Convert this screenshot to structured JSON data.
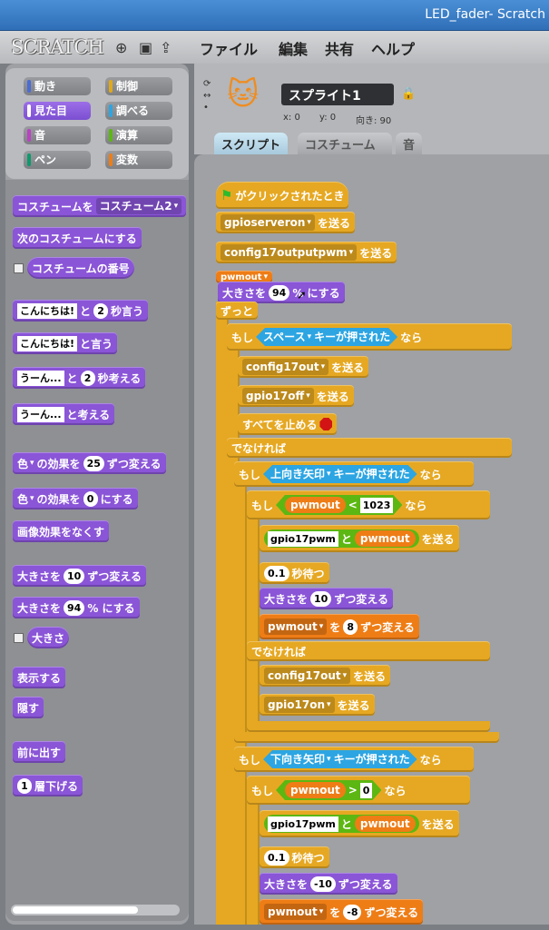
{
  "window": {
    "title": "LED_fader- Scratch"
  },
  "menu": {
    "logo": "SCRATCH",
    "items": [
      "ファイル",
      "編集",
      "共有",
      "ヘルプ"
    ]
  },
  "categories": [
    {
      "label": "動き",
      "color": "#4a6cd4"
    },
    {
      "label": "制御",
      "color": "#e1a91a"
    },
    {
      "label": "見た目",
      "color": "#8a55d7"
    },
    {
      "label": "調べる",
      "color": "#2ca5e2"
    },
    {
      "label": "音",
      "color": "#bb42c3"
    },
    {
      "label": "演算",
      "color": "#5cb712"
    },
    {
      "label": "ペン",
      "color": "#0e9a6c"
    },
    {
      "label": "変数",
      "color": "#ee7d16"
    }
  ],
  "palette": {
    "costume_to": "コスチュームを",
    "costume_name": "コスチューム2",
    "next_costume": "次のコスチュームにする",
    "costume_number": "コスチュームの番号",
    "say_for_text": "こんにちは!",
    "say_for_and": "と",
    "say_for_secs": "2",
    "say_for_suffix": "秒言う",
    "say_text": "こんにちは!",
    "say_suffix": "と言う",
    "think_for_text": "うーん...",
    "think_for_and": "と",
    "think_for_secs": "2",
    "think_for_suffix": "秒考える",
    "think_text": "うーん...",
    "think_suffix": "と考える",
    "effect_change_name": "色",
    "effect_change_of": "の効果を",
    "effect_change_val": "25",
    "effect_change_suffix": "ずつ変える",
    "effect_set_name": "色",
    "effect_set_of": "の効果を",
    "effect_set_val": "0",
    "effect_set_suffix": "にする",
    "clear_effects": "画像効果をなくす",
    "size_change_prefix": "大きさを",
    "size_change_val": "10",
    "size_change_suffix": "ずつ変える",
    "size_set_prefix": "大きさを",
    "size_set_val": "94",
    "size_set_suffix": "% にする",
    "size_reporter": "大きさ",
    "show": "表示する",
    "hide": "隠す",
    "front": "前に出す",
    "back_val": "1",
    "back_suffix": "層下げる"
  },
  "sprite": {
    "name": "スプライト1",
    "x_label": "x: 0",
    "y_label": "y: 0",
    "dir_label": "向き: 90"
  },
  "tabs": [
    "スクリプト",
    "コスチューム",
    "音"
  ],
  "script": {
    "hat": "がクリックされたとき",
    "b1_msg": "gpioserveron",
    "send": "を送る",
    "b2_msg": "config17outputpwm",
    "b3_var": "pwmout",
    "size_prefix": "大きさを",
    "size_val": "94",
    "size_suffix": "% にする",
    "forever": "ずっと",
    "if": "もし",
    "then": "なら",
    "else": "でなければ",
    "key_space": "スペース",
    "key_pressed": "キーが押された",
    "c17out": "config17out",
    "g17off": "gpio17off",
    "stop_all": "すべてを止める",
    "key_up": "上向き矢印",
    "pwmout": "pwmout",
    "lt": "<",
    "lt_val": "1023",
    "gpio17pwm": "gpio17pwm",
    "join_and": "と",
    "wait_val": "0.1",
    "wait_suffix": "秒待つ",
    "size_chg_val": "10",
    "size_chg_suffix": "ずつ変える",
    "var_chg_to": "を",
    "var_chg_val": "8",
    "var_chg_suffix": "ずつ変える",
    "g17on": "gpio17on",
    "key_down": "下向き矢印",
    "gt": ">",
    "gt_val": "0",
    "size_chg_val2": "-10",
    "var_chg_val2": "-8"
  }
}
